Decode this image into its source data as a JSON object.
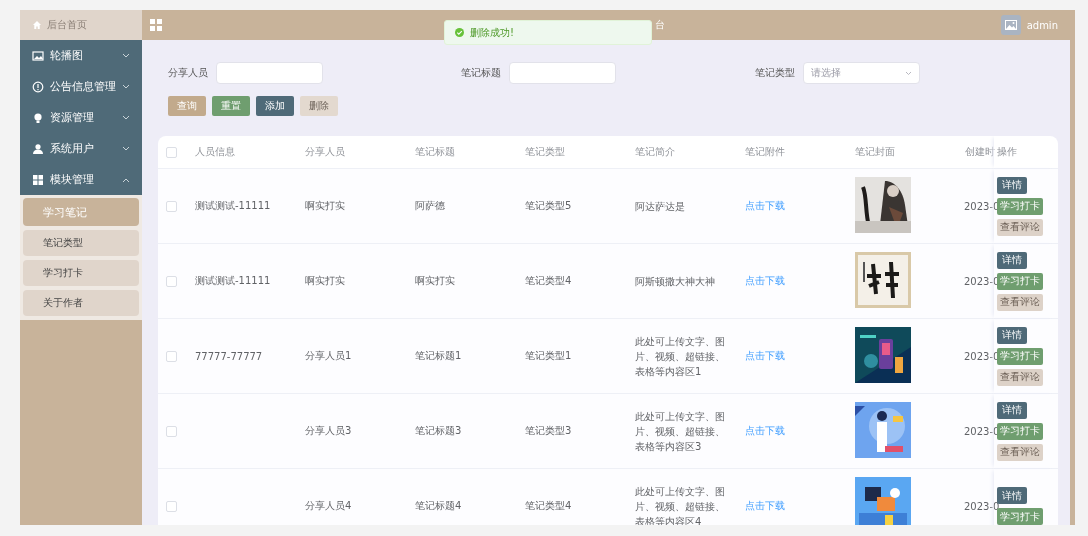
{
  "sidebar": {
    "home": "后台首页",
    "menus": [
      {
        "label": "轮播图",
        "expanded": false
      },
      {
        "label": "公告信息管理",
        "expanded": false
      },
      {
        "label": "资源管理",
        "expanded": false
      },
      {
        "label": "系统用户",
        "expanded": false
      },
      {
        "label": "模块管理",
        "expanded": true,
        "children": [
          {
            "label": "学习笔记",
            "selected": true
          },
          {
            "label": "笔记类型",
            "selected": false
          },
          {
            "label": "学习打卡",
            "selected": false
          },
          {
            "label": "关于作者",
            "selected": false
          }
        ]
      }
    ]
  },
  "header": {
    "title": "台",
    "user": "admin"
  },
  "toast": {
    "message": "删除成功!"
  },
  "search": {
    "fields": [
      {
        "label": "分享人员",
        "kind": "input"
      },
      {
        "label": "笔记标题",
        "kind": "input"
      },
      {
        "label": "笔记类型",
        "kind": "select",
        "placeholder": "请选择"
      }
    ],
    "buttons": [
      {
        "label": "查询",
        "kind": "query",
        "disabled": false
      },
      {
        "label": "重置",
        "kind": "reset",
        "disabled": false
      },
      {
        "label": "添加",
        "kind": "add",
        "disabled": false
      },
      {
        "label": "删除",
        "kind": "delete",
        "disabled": true
      }
    ]
  },
  "table": {
    "select_all_checked": false,
    "columns": [
      "人员信息",
      "分享人员",
      "笔记标题",
      "笔记类型",
      "笔记简介",
      "笔记附件",
      "笔记封面",
      "创建时",
      "操作"
    ],
    "rows": [
      {
        "checked": false,
        "person_info": "测试测试-11111",
        "sharer": "啊实打实",
        "title": "阿萨德",
        "type": "笔记类型5",
        "intro": "阿达萨达是",
        "attachment": "点击下载",
        "cover": {
          "kind": "picture"
        },
        "created": "2023-0",
        "actions": [
          {
            "label": "详情",
            "kind": "detail"
          },
          {
            "label": "学习打卡",
            "kind": "checkin"
          },
          {
            "label": "查看评论",
            "kind": "comments"
          }
        ]
      },
      {
        "checked": false,
        "person_info": "测试测试-11111",
        "sharer": "啊实打实",
        "title": "啊实打实",
        "type": "笔记类型4",
        "intro": "阿斯顿撒大神大神",
        "attachment": "点击下载",
        "cover": {
          "kind": "picture"
        },
        "created": "2023-0",
        "actions": [
          {
            "label": "详情",
            "kind": "detail"
          },
          {
            "label": "学习打卡",
            "kind": "checkin"
          },
          {
            "label": "查看评论",
            "kind": "comments"
          }
        ]
      },
      {
        "checked": false,
        "person_info": "77777-77777",
        "sharer": "分享人员1",
        "title": "笔记标题1",
        "type": "笔记类型1",
        "intro": "此处可上传文字、图片、视频、超链接、表格等内容区1",
        "attachment": "点击下载",
        "cover": {
          "kind": "picture"
        },
        "created": "2023-0",
        "actions": [
          {
            "label": "详情",
            "kind": "detail"
          },
          {
            "label": "学习打卡",
            "kind": "checkin"
          },
          {
            "label": "查看评论",
            "kind": "comments"
          }
        ]
      },
      {
        "checked": false,
        "sharer": "分享人员3",
        "title": "笔记标题3",
        "type": "笔记类型3",
        "intro": "此处可上传文字、图片、视频、超链接、表格等内容区3",
        "attachment": "点击下载",
        "cover": {
          "kind": "picture"
        },
        "created": "2023-0",
        "actions": [
          {
            "label": "详情",
            "kind": "detail"
          },
          {
            "label": "学习打卡",
            "kind": "checkin"
          },
          {
            "label": "查看评论",
            "kind": "comments"
          }
        ]
      },
      {
        "checked": false,
        "sharer": "分享人员4",
        "title": "笔记标题4",
        "type": "笔记类型4",
        "intro": "此处可上传文字、图片、视频、超链接、表格等内容区4",
        "attachment": "点击下载",
        "cover": {
          "kind": "picture"
        },
        "created": "2023-0",
        "actions": [
          {
            "label": "详情",
            "kind": "detail"
          },
          {
            "label": "学习打卡",
            "kind": "checkin"
          }
        ]
      }
    ]
  }
}
